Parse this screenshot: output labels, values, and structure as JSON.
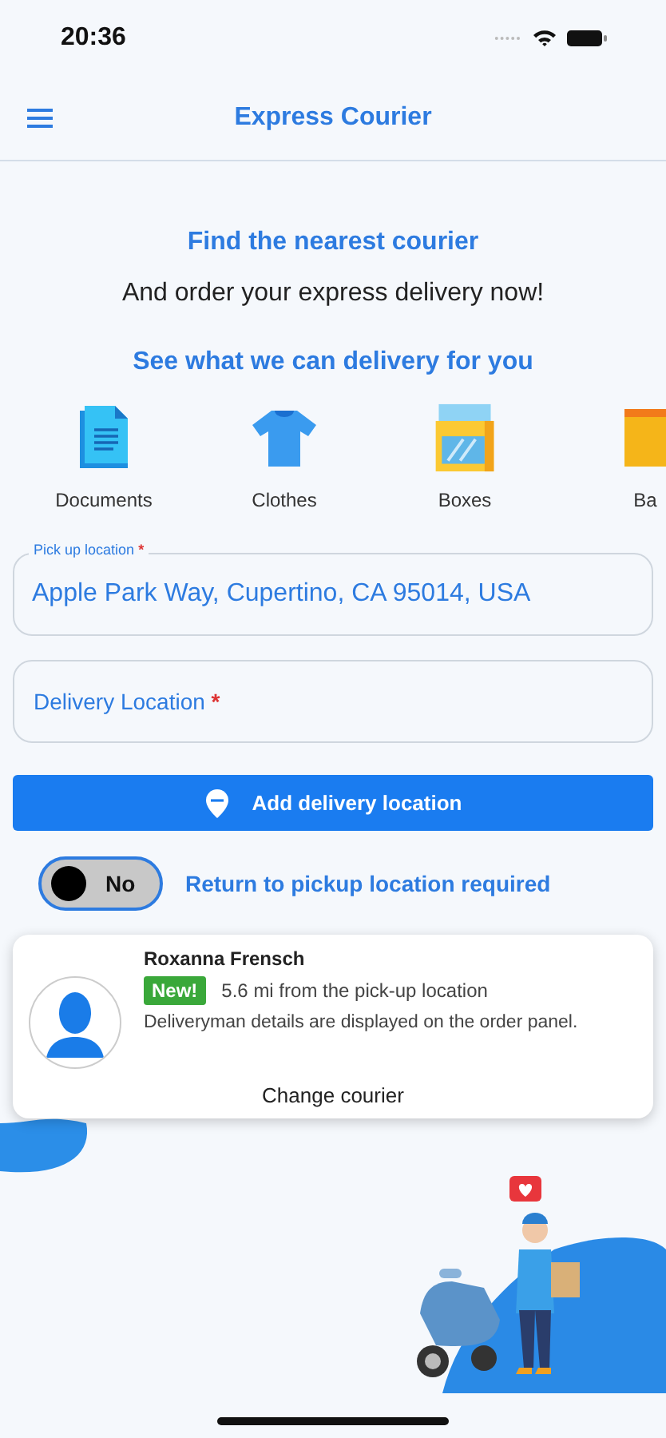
{
  "status_bar": {
    "time": "20:36"
  },
  "header": {
    "title": "Express Courier"
  },
  "intro": {
    "title": "Find the nearest courier",
    "subtitle": "And order your express delivery now!",
    "prompt": "See what we can delivery for you"
  },
  "categories": [
    {
      "kind": "documents",
      "label": "Documents"
    },
    {
      "kind": "clothes",
      "label": "Clothes"
    },
    {
      "kind": "boxes",
      "label": "Boxes"
    },
    {
      "kind": "bags",
      "label": "Ba"
    }
  ],
  "pickup": {
    "label": "Pick up location",
    "required": true,
    "required_mark": "*",
    "value": "Apple Park Way, Cupertino, CA 95014, USA"
  },
  "delivery": {
    "placeholder": "Delivery Location",
    "required": true,
    "required_mark": "*"
  },
  "add_button": "Add delivery location",
  "return_toggle": {
    "on": false,
    "state_label": "No",
    "label": "Return to pickup location required"
  },
  "courier": {
    "name": "Roxanna Frensch",
    "badge": "New!",
    "distance": "5.6 mi from the pick-up location",
    "note": "Deliveryman details are displayed on the order panel.",
    "action": "Change courier"
  }
}
